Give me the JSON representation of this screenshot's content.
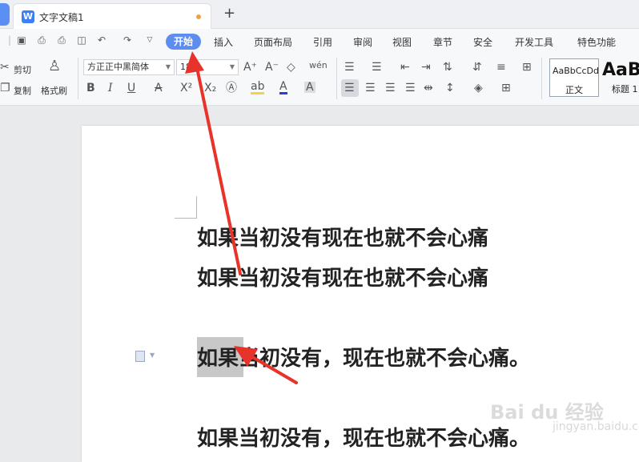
{
  "tabs": {
    "doc_title": "文字文稿1",
    "new_tab_symbol": "+"
  },
  "menu": {
    "items": [
      "开始",
      "插入",
      "页面布局",
      "引用",
      "审阅",
      "视图",
      "章节",
      "安全",
      "开发工具",
      "特色功能"
    ],
    "active_index": 0,
    "active_color": "#5e8df0"
  },
  "ribbon": {
    "cut_label": "剪切",
    "copy_label": "复制",
    "format_painter_label": "格式刷",
    "font_name": "方正正中黑简体",
    "font_size": "18",
    "bold": "B",
    "italic": "I",
    "underline": "U",
    "styles": [
      {
        "sample": "AaBbCcDd",
        "name": "正文"
      },
      {
        "sample": "AaB",
        "name": "标题 1"
      }
    ]
  },
  "document": {
    "lines": [
      "如果当初没有现在也就不会心痛",
      "如果当初没有现在也就不会心痛",
      "如果当初没有，现在也就不会心痛。",
      "如果当初没有，现在也就不会心痛。"
    ],
    "selected_text": "如果"
  },
  "watermark": {
    "text": "Bai du 经验",
    "sub": "jingyan.baidu.com"
  },
  "annotation_color": "#e8332a"
}
